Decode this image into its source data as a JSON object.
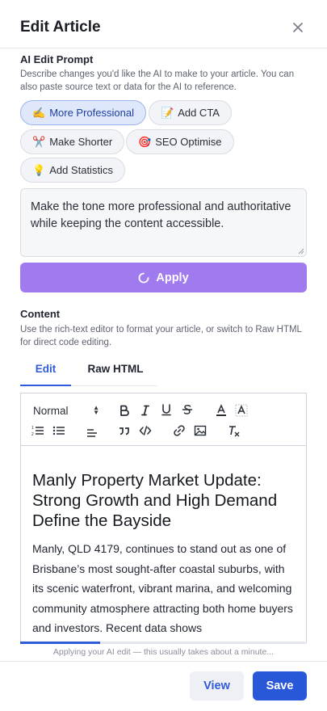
{
  "header": {
    "title": "Edit Article"
  },
  "prompt_section": {
    "title": "AI Edit Prompt",
    "description": "Describe changes you'd like the AI to make to your article. You can also paste source text or data for the AI to reference.",
    "chips": [
      {
        "emoji": "✍️",
        "label": "More Professional",
        "active": true
      },
      {
        "emoji": "📝",
        "label": "Add CTA"
      },
      {
        "emoji": "✂️",
        "label": "Make Shorter"
      },
      {
        "emoji": "🎯",
        "label": "SEO Optimise"
      },
      {
        "emoji": "💡",
        "label": "Add Statistics"
      }
    ],
    "prompt_value": "Make the tone more professional and authoritative while keeping the content accessible.",
    "apply_label": "Apply"
  },
  "content_section": {
    "title": "Content",
    "description": "Use the rich-text editor to format your article, or switch to Raw HTML for direct code editing.",
    "tabs": [
      "Edit",
      "Raw HTML"
    ],
    "active_tab": "Edit"
  },
  "editor": {
    "format_select": "Normal",
    "heading": "Manly Property Market Update: Strong Growth and High Demand Define the Bayside",
    "paragraph": "Manly, QLD 4179, continues to stand out as one of Brisbane’s most sought-after coastal suburbs, with its scenic waterfront, vibrant marina, and welcoming community atmosphere attracting both home buyers and investors. Recent data shows"
  },
  "progress": {
    "fraction": 0.28
  },
  "status_text": "Applying your AI edit — this usually takes about a minute...",
  "footer": {
    "view_label": "View",
    "save_label": "Save"
  },
  "colors": {
    "accent": "#2f5bd8",
    "apply": "#a07bf0",
    "chip_active": "#dfe8fb"
  }
}
